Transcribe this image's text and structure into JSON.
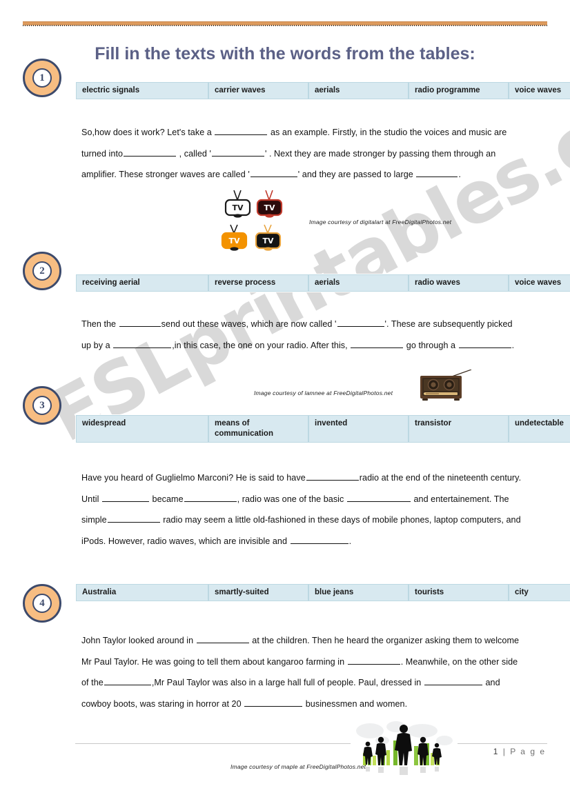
{
  "document": {
    "title": "Fill in the texts with the words from the tables:",
    "watermark": "ESLprintables.com",
    "page_label_number": "1",
    "page_label_separator": "|",
    "page_label_text": "P a g e"
  },
  "sections": [
    {
      "badge": "1",
      "table": {
        "words": [
          "electric signals",
          "carrier waves",
          "aerials",
          "radio programme",
          "voice waves"
        ]
      },
      "text_parts": [
        "So,how does it work? Let's take a ",
        " as an example. Firstly, in the studio the voices and music are turned into",
        " , called '",
        "' . Next they are made stronger by passing them through an amplifier.  These stronger waves are called '",
        "' and they are passed to large ",
        "."
      ],
      "caption": "Image courtesy of digitalart at FreeDigitalPhotos.net",
      "image_name": "tv-sets-illustration"
    },
    {
      "badge": "2",
      "table": {
        "words": [
          "receiving aerial",
          "reverse process",
          "aerials",
          "radio waves",
          "voice waves"
        ]
      },
      "text_parts": [
        "Then the ",
        "send out these waves, which are now called '",
        "'. These are subsequently picked up by a ",
        ",in this case, the one on your radio. After this, ",
        " go through a ",
        "."
      ],
      "caption": "Image courtesy of lamnee at FreeDigitalPhotos.net",
      "image_name": "vintage-radio-photo"
    },
    {
      "badge": "3",
      "table": {
        "words": [
          "widespread",
          "means of communication",
          "invented",
          "transistor",
          "undetectable"
        ]
      },
      "text_parts": [
        "Have you heard of Guglielmo Marconi? He is said to have",
        "radio at the end of the nineteenth century. Until ",
        " became",
        ", radio was one of the basic ",
        " and entertainement. The simple",
        " radio may seem a little old-fashioned in these days of mobile phones, laptop computers, and iPods.  However, radio waves, which are invisible and ",
        "."
      ],
      "caption": "",
      "image_name": ""
    },
    {
      "badge": "4",
      "table": {
        "words": [
          "Australia",
          "smartly-suited",
          "blue jeans",
          "tourists",
          "city"
        ]
      },
      "text_parts": [
        " John  Taylor looked around in ",
        " at the children. Then he heard the organizer asking them to welcome Mr Paul Taylor. He was going to tell them about kangaroo farming in ",
        ". Meanwhile, on the other side of the",
        ",Mr Paul Taylor was also in  a large hall full of people. Paul, dressed in ",
        " and  cowboy boots, was staring in horror at 20 ",
        " businessmen and women."
      ],
      "caption": "Image courtesy of maple at FreeDigitalPhotos.net",
      "image_name": "business-people-silhouettes"
    }
  ],
  "colors": {
    "title": "#5b6086",
    "table_fill": "#d8e9f0",
    "table_border": "#bcd8e2",
    "badge_fill": "#f7bd82",
    "badge_stroke": "#3d4a6b",
    "top_border": "#dd9b5e"
  }
}
